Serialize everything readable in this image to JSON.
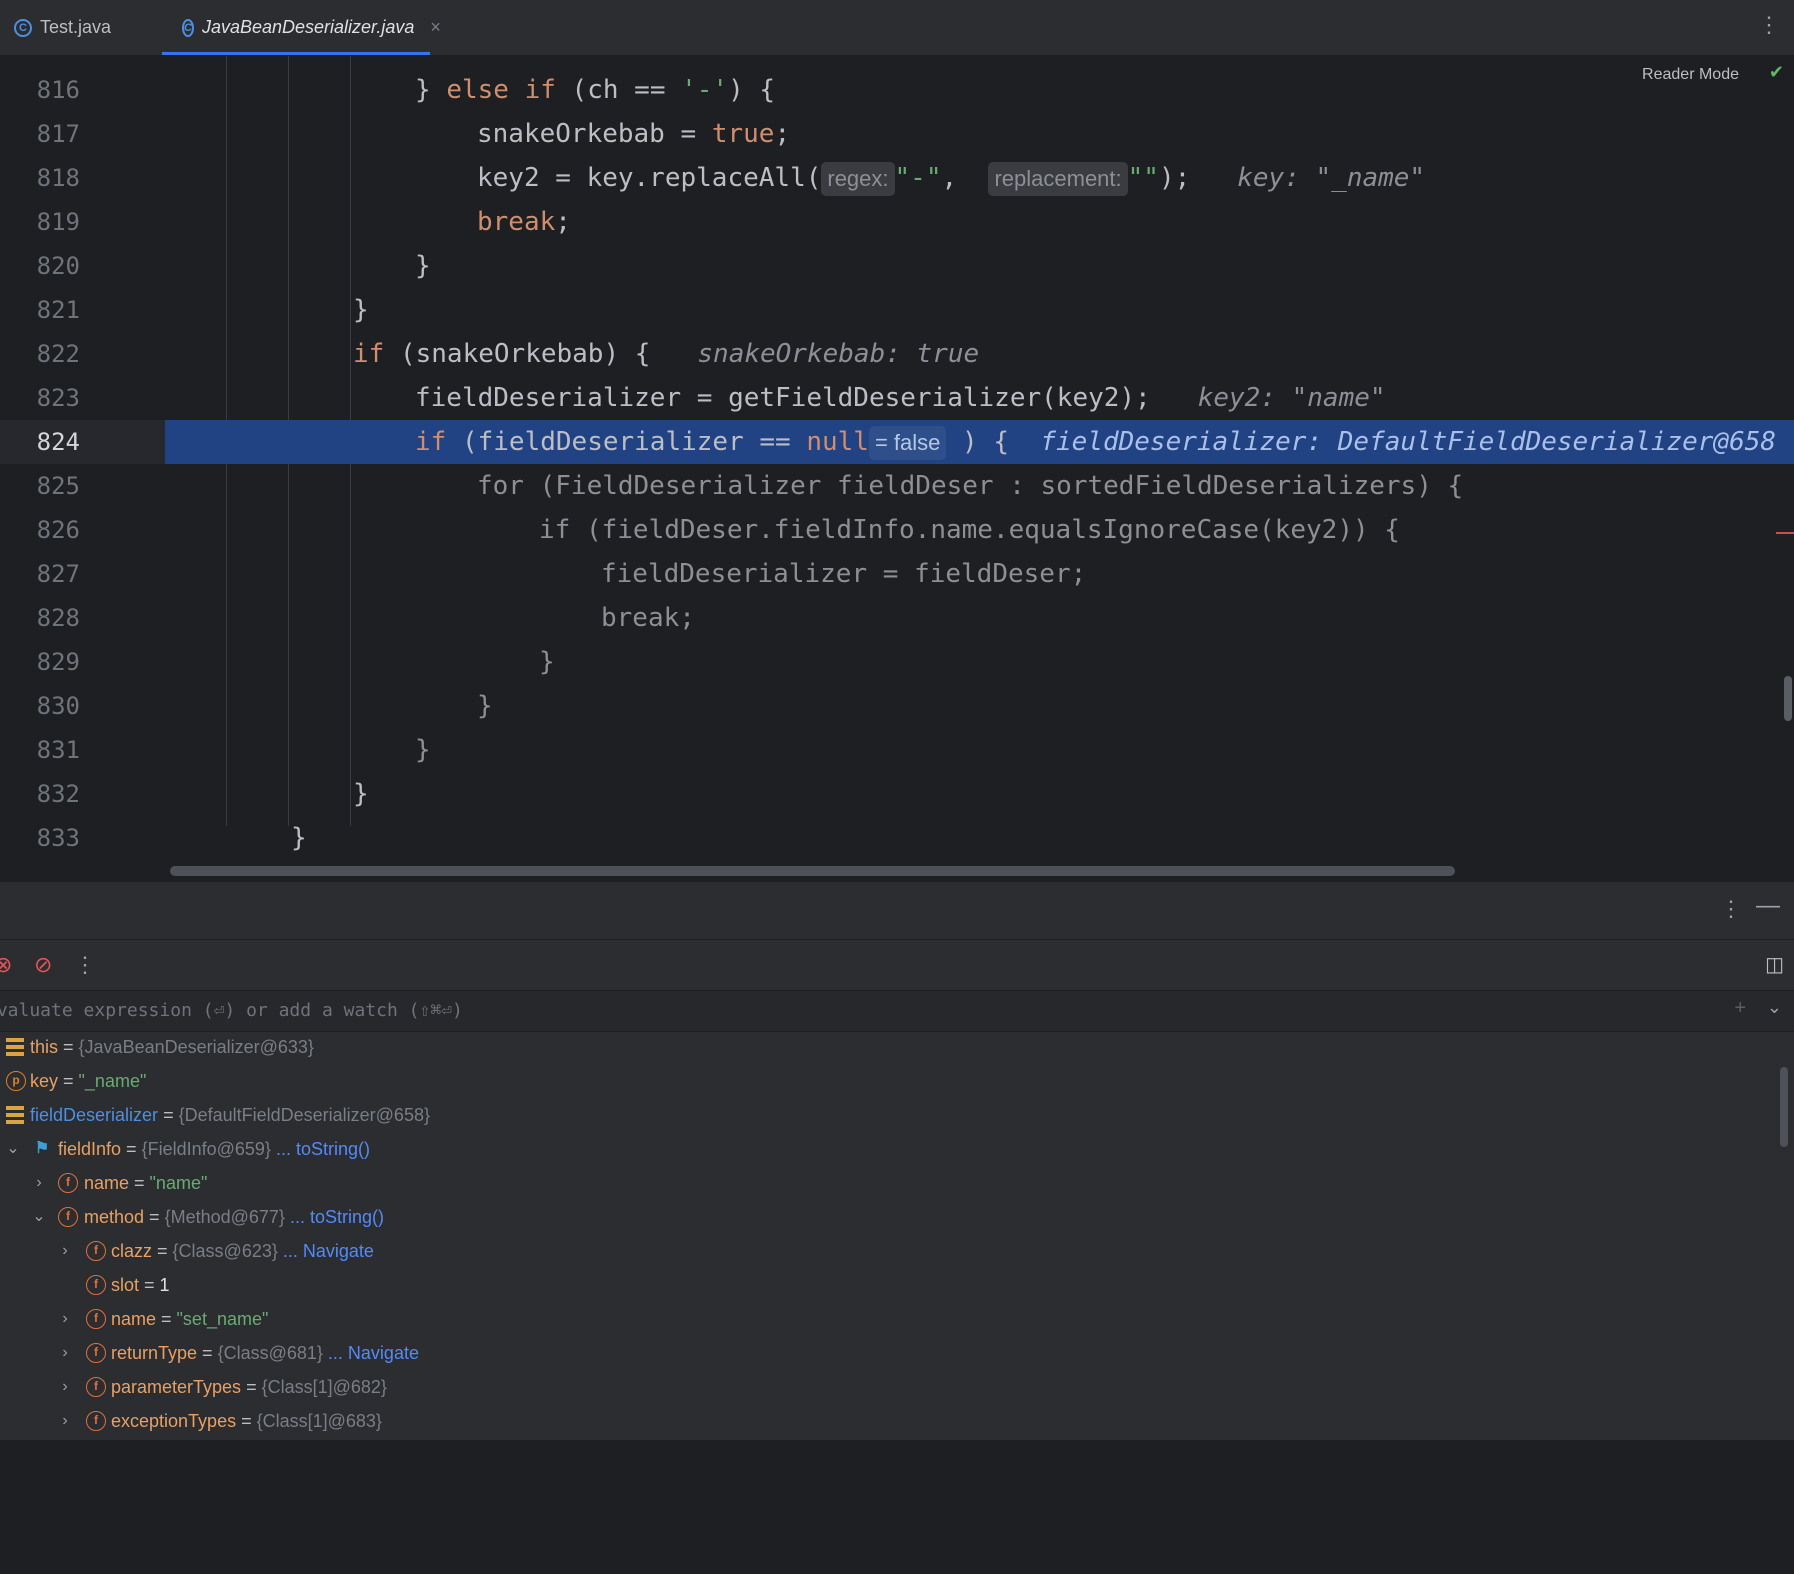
{
  "tabs": [
    {
      "label": "Test.java",
      "active": false
    },
    {
      "label": "JavaBeanDeserializer.java",
      "active": true
    }
  ],
  "editor": {
    "reader_mode": "Reader Mode",
    "lines": [
      {
        "num": "816",
        "text": "            } else if (ch == '-') {"
      },
      {
        "num": "817",
        "text": "                snakeOrkebab = true;"
      },
      {
        "num": "818",
        "text": "                key2 = key.replaceAll( regex: \"-\",  replacement: \"\");   key: \"_name\""
      },
      {
        "num": "819",
        "text": "                break;"
      },
      {
        "num": "820",
        "text": "            }"
      },
      {
        "num": "821",
        "text": "        }"
      },
      {
        "num": "822",
        "text": "        if (snakeOrkebab) {   snakeOrkebab: true"
      },
      {
        "num": "823",
        "text": "            fieldDeserializer = getFieldDeserializer(key2);   key2: \"name\""
      },
      {
        "num": "824",
        "text": "            if (fieldDeserializer == null = false ) {   fieldDeserializer: DefaultFieldDeserializer@658"
      },
      {
        "num": "825",
        "text": "                for (FieldDeserializer fieldDeser : sortedFieldDeserializers) {"
      },
      {
        "num": "826",
        "text": "                    if (fieldDeser.fieldInfo.name.equalsIgnoreCase(key2)) {"
      },
      {
        "num": "827",
        "text": "                        fieldDeserializer = fieldDeser;"
      },
      {
        "num": "828",
        "text": "                        break;"
      },
      {
        "num": "829",
        "text": "                    }"
      },
      {
        "num": "830",
        "text": "                }"
      },
      {
        "num": "831",
        "text": "            }"
      },
      {
        "num": "832",
        "text": "        }"
      },
      {
        "num": "833",
        "text": "    }"
      },
      {
        "num": "834",
        "text": ""
      }
    ],
    "tokens": {
      "else_if": "else if",
      "ch_cmp": "(ch == ",
      "dash_str": "'-'",
      "open_brace": ") {",
      "snake_assign": "snakeOrkebab = ",
      "true_kw": "true",
      "semicolon": ";",
      "key2_assign": "key2 = key.replaceAll(",
      "regex_hint": "regex:",
      "dash_literal": "\"-\"",
      "comma": ",",
      "replacement_hint": "replacement:",
      "empty_literal": "\"\"",
      "close_call": ");",
      "key_inline": "key: \"_name\"",
      "break_kw": "break",
      "close_brace": "}",
      "if_kw": "if",
      "snake_cond": " (snakeOrkebab) {",
      "snake_inline": "snakeOrkebab: true",
      "fd_assign": "fieldDeserializer = getFieldDeserializer(key2);",
      "key2_inline": "key2: \"name\"",
      "fd_cond": " (fieldDeserializer == ",
      "null_kw": "null",
      "false_hint": "= false",
      "cond_close": " ) {",
      "fd_inline": "fieldDeserializer: DefaultFieldDeserializer@658",
      "for_line": "for (FieldDeserializer fieldDeser : sortedFieldDeserializers) {",
      "if_line": "if (fieldDeser.fieldInfo.name.equalsIgnoreCase(key2)) {",
      "fd_assign2": "fieldDeserializer = fieldDeser;",
      "break_line": "break;"
    }
  },
  "debugger": {
    "eval_placeholder": "Evaluate expression (⏎) or add a watch (⇧⌘⏎)",
    "variables": [
      {
        "name": "this",
        "eq": " = ",
        "value": "{JavaBeanDeserializer@633}",
        "link": ""
      },
      {
        "name": "key",
        "eq": " = ",
        "value": "\"_name\"",
        "link": ""
      },
      {
        "name": "fieldDeserializer",
        "eq": " = ",
        "value": "{DefaultFieldDeserializer@658}",
        "link": ""
      },
      {
        "name": "fieldInfo",
        "eq": " = ",
        "value": "{FieldInfo@659}",
        "link": "... toString()"
      },
      {
        "name": "name",
        "eq": " = ",
        "value": "\"name\"",
        "link": ""
      },
      {
        "name": "method",
        "eq": " = ",
        "value": "{Method@677}",
        "link": "... toString()"
      },
      {
        "name": "clazz",
        "eq": " = ",
        "value": "{Class@623}",
        "link": "... Navigate"
      },
      {
        "name": "slot",
        "eq": " = ",
        "value": "1",
        "link": ""
      },
      {
        "name": "name",
        "eq": " = ",
        "value": "\"set_name\"",
        "link": ""
      },
      {
        "name": "returnType",
        "eq": " = ",
        "value": "{Class@681}",
        "link": "... Navigate"
      },
      {
        "name": "parameterTypes",
        "eq": " = ",
        "value": "{Class[1]@682}",
        "link": ""
      },
      {
        "name": "exceptionTypes",
        "eq": " = ",
        "value": "{Class[1]@683}",
        "link": ""
      }
    ]
  },
  "icons": {
    "field_letter": "f",
    "param_letter": "p"
  },
  "colors": {
    "execution_line": "#214283",
    "keyword": "#cf8e6d",
    "string": "#6aab73",
    "link": "#548af7"
  }
}
